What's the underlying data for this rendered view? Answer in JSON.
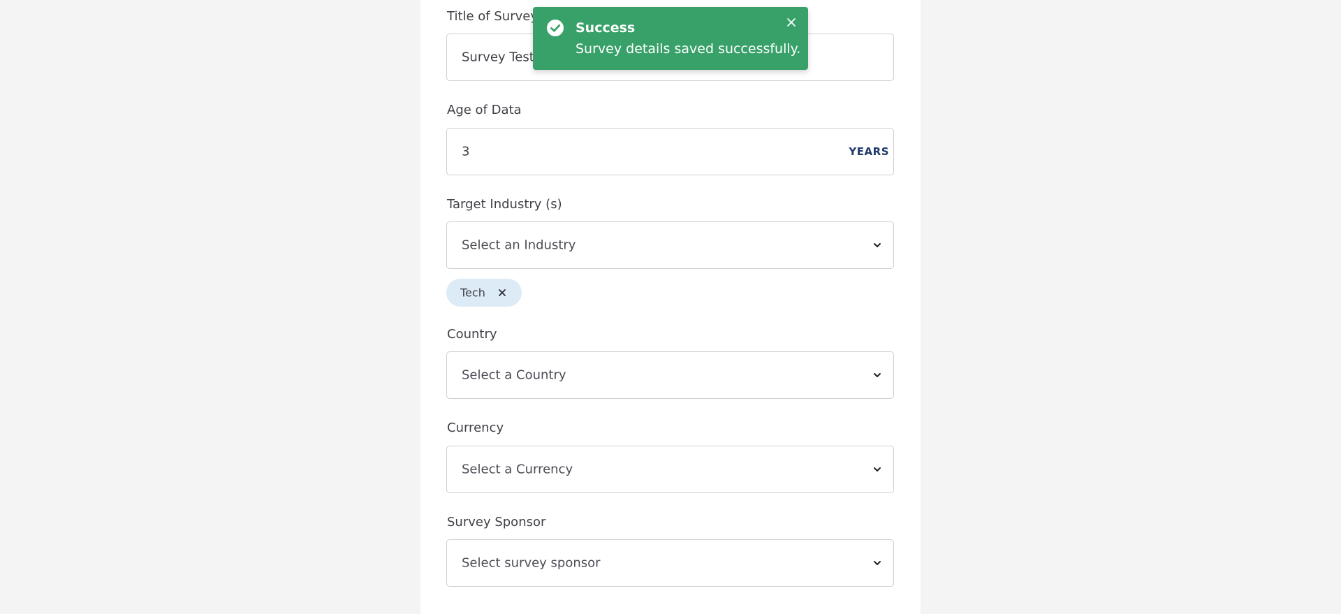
{
  "form": {
    "title_of_survey": {
      "label": "Title of Survey",
      "value": "Survey Test"
    },
    "age_of_data": {
      "label": "Age of Data",
      "value": "3",
      "unit": "YEARS"
    },
    "target_industry": {
      "label": "Target Industry (s)",
      "placeholder": "Select an Industry",
      "selected_chips": [
        "Tech"
      ]
    },
    "country": {
      "label": "Country",
      "placeholder": "Select a Country"
    },
    "currency": {
      "label": "Currency",
      "placeholder": "Select a Currency"
    },
    "survey_sponsor": {
      "label": "Survey Sponsor",
      "placeholder": "Select survey sponsor"
    }
  },
  "toast": {
    "title": "Success",
    "message": "Survey details saved successfully.",
    "icon": "check-circle-icon",
    "close_icon": "close-icon",
    "background_color": "#38a169"
  },
  "colors": {
    "page_background": "#f4f4f4",
    "panel_background": "#ffffff",
    "input_border": "#cfcfd4",
    "chip_background": "#dcebf5",
    "unit_text": "#1f3a6b"
  }
}
